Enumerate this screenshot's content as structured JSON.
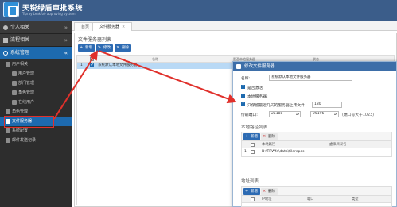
{
  "header": {
    "app_name": "天锐绿盾审批系统",
    "app_subtitle": "Tipray Leakfo0 approving system"
  },
  "sidebar": {
    "groups": [
      {
        "label": "个人相关",
        "chevron": "»"
      },
      {
        "label": "流程相关",
        "chevron": "»"
      },
      {
        "label": "系统管理",
        "chevron": "«"
      }
    ],
    "items": [
      {
        "label": "用户相关",
        "level": 1
      },
      {
        "label": "用户管理",
        "level": 2
      },
      {
        "label": "部门管理",
        "level": 2
      },
      {
        "label": "角色管理",
        "level": 2
      },
      {
        "label": "在线用户",
        "level": 2
      },
      {
        "label": "角色管理",
        "level": 1
      },
      {
        "label": "文件服务器",
        "level": 1,
        "active": true
      },
      {
        "label": "系统配置",
        "level": 1
      },
      {
        "label": "邮件发送记录",
        "level": 1
      }
    ]
  },
  "tabs": [
    {
      "label": "首页"
    },
    {
      "label": "文件服务器",
      "close": "×",
      "active": true
    }
  ],
  "main": {
    "title": "文件服务器列表",
    "toolbar": {
      "add": "新增",
      "edit": "修改",
      "delete": "删除"
    },
    "columns": {
      "name": "名称",
      "local": "是否本地服务器",
      "status": "状态"
    },
    "rows": [
      {
        "index": "1",
        "name": "系统默认本地文件服务器"
      }
    ]
  },
  "dialog": {
    "title": "修改文件服务器",
    "name_label": "名称:",
    "name_value": "系统默认本地文件服务器",
    "enable_label": "是否激活",
    "local_label": "本地服务器:",
    "retain_label": "只保留最近几天的服务器上传文件",
    "retain_value": "180",
    "port_label": "传输端口:",
    "port_from": "25188",
    "port_sep": "—",
    "port_to": "25196",
    "port_hint": "(端口号大于1023)",
    "local_paths": {
      "title": "本地路径列表",
      "add": "新增",
      "delete": "删除",
      "col_path": "本地路径",
      "col_virtual": "虚拟目录名",
      "rows": [
        {
          "index": "1",
          "path": "D:\\TRWfe\\data\\filerepos"
        }
      ]
    },
    "addresses": {
      "title": "地址列表",
      "add": "新增",
      "delete": "删除",
      "col_ip": "IP地址",
      "col_port": "端口",
      "col_type": "类型"
    }
  },
  "colors": {
    "header": "#3b5d8a",
    "sidebar": "#2d2d2d",
    "accent": "#1d6aaf",
    "highlight": "#e0302b",
    "row_selected": "#b9d9f5"
  }
}
